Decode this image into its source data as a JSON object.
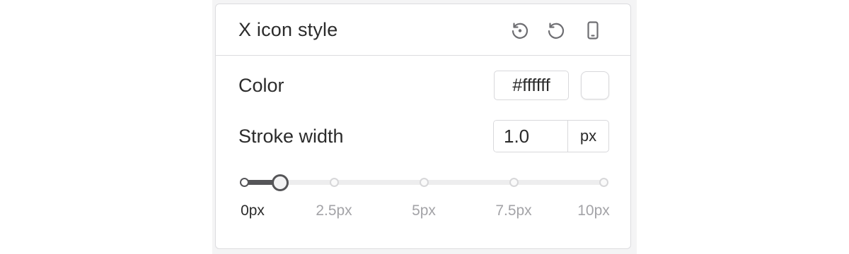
{
  "panel": {
    "title": "X icon style",
    "header_icons": [
      "reset-to-default-icon",
      "reset-icon",
      "mobile-device-icon"
    ]
  },
  "color": {
    "label": "Color",
    "value": "#ffffff",
    "swatch": "#ffffff"
  },
  "stroke": {
    "label": "Stroke width",
    "value": "1.0",
    "unit": "px"
  },
  "slider": {
    "value": 1.0,
    "min": 0,
    "max": 10,
    "marks": [
      {
        "value": 0,
        "label": "0px"
      },
      {
        "value": 2.5,
        "label": "2.5px"
      },
      {
        "value": 5,
        "label": "5px"
      },
      {
        "value": 7.5,
        "label": "7.5px"
      },
      {
        "value": 10,
        "label": "10px"
      }
    ]
  },
  "colors": {
    "accent": "#555558",
    "border": "#dcdcdf",
    "track": "#ededee",
    "muted_text": "#a3a3a7"
  }
}
